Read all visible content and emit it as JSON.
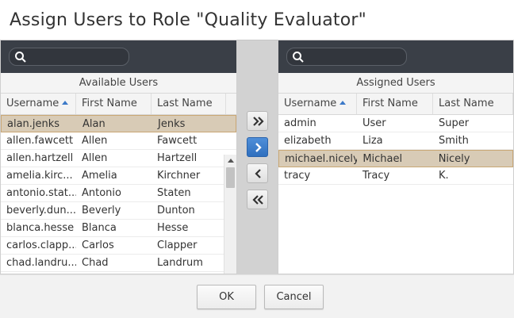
{
  "dialog": {
    "title": "Assign Users to Role \"Quality Evaluator\""
  },
  "available": {
    "search_placeholder": "",
    "caption": "Available Users",
    "columns": [
      "Username",
      "First Name",
      "Last Name"
    ],
    "sort": {
      "column": "Username",
      "direction": "ascending"
    },
    "rows": [
      {
        "username": "alan.jenks",
        "first": "Alan",
        "last": "Jenks",
        "selected": true
      },
      {
        "username": "allen.fawcett",
        "first": "Allen",
        "last": "Fawcett",
        "selected": false
      },
      {
        "username": "allen.hartzell",
        "first": "Allen",
        "last": "Hartzell",
        "selected": false
      },
      {
        "username": "amelia.kirc...",
        "first": "Amelia",
        "last": "Kirchner",
        "selected": false
      },
      {
        "username": "antonio.stat...",
        "first": "Antonio",
        "last": "Staten",
        "selected": false
      },
      {
        "username": "beverly.dun...",
        "first": "Beverly",
        "last": "Dunton",
        "selected": false
      },
      {
        "username": "blanca.hesse",
        "first": "Blanca",
        "last": "Hesse",
        "selected": false
      },
      {
        "username": "carlos.clapp...",
        "first": "Carlos",
        "last": "Clapper",
        "selected": false
      },
      {
        "username": "chad.landru...",
        "first": "Chad",
        "last": "Landrum",
        "selected": false
      }
    ]
  },
  "assigned": {
    "search_placeholder": "",
    "caption": "Assigned Users",
    "columns": [
      "Username",
      "First Name",
      "Last Name"
    ],
    "sort": {
      "column": "Username",
      "direction": "ascending"
    },
    "rows": [
      {
        "username": "admin",
        "first": "User",
        "last": "Super",
        "selected": false
      },
      {
        "username": "elizabeth",
        "first": "Liza",
        "last": "Smith",
        "selected": false
      },
      {
        "username": "michael.nicely",
        "first": "Michael",
        "last": "Nicely",
        "selected": true
      },
      {
        "username": "tracy",
        "first": "Tracy",
        "last": "K.",
        "selected": false
      }
    ]
  },
  "move_buttons": [
    {
      "icon": "double-chevron-right-icon",
      "action": "add-all"
    },
    {
      "icon": "chevron-right-icon",
      "action": "add-selected"
    },
    {
      "icon": "chevron-left-icon",
      "action": "remove-selected"
    },
    {
      "icon": "double-chevron-left-icon",
      "action": "remove-all"
    }
  ],
  "footer": {
    "ok_label": "OK",
    "cancel_label": "Cancel"
  },
  "colors": {
    "selection": "#d8cbb6",
    "search_bar": "#3a3f47",
    "primary_button": "#2f6fbe",
    "sort_arrow": "#3c79c8"
  }
}
